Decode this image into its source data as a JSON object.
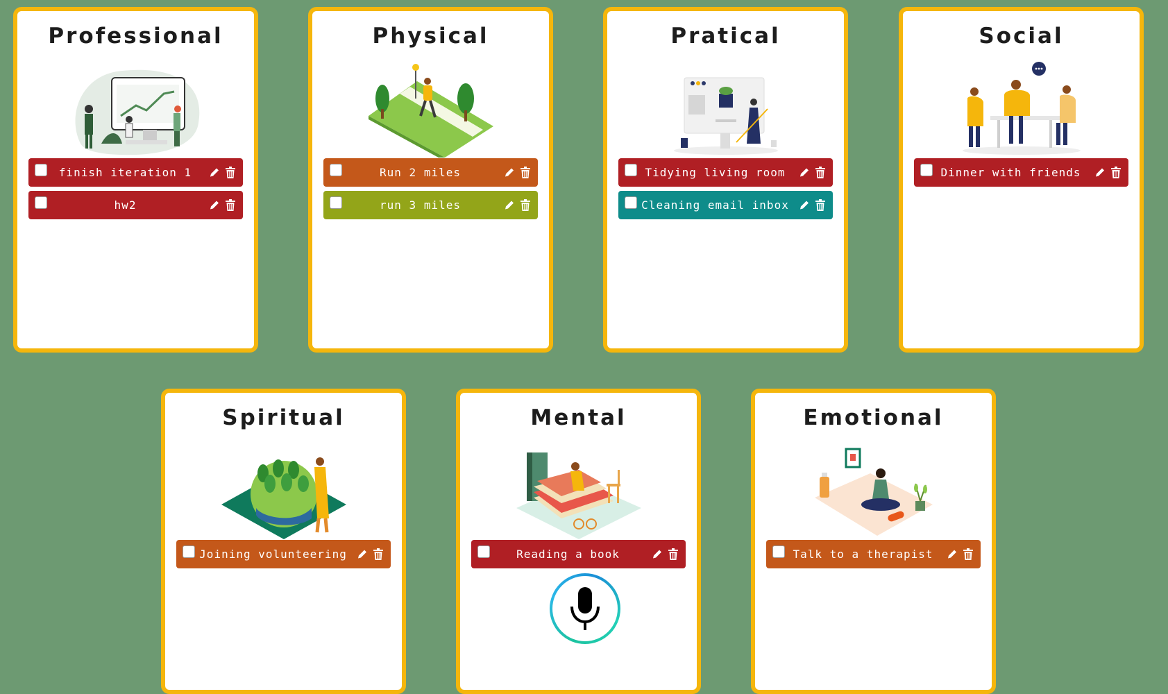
{
  "colors": {
    "background": "#6d9a72",
    "card_border": "#f5b60c",
    "red": "#b01f24",
    "orange": "#c4581a",
    "olive": "#93a519",
    "teal": "#0e8c8a"
  },
  "cards": [
    {
      "title": "Professional",
      "illustration": "presentation-chart-illustration",
      "tasks": [
        {
          "label": "finish iteration 1",
          "color": "#b01f24"
        },
        {
          "label": "hw2",
          "color": "#b01f24"
        }
      ]
    },
    {
      "title": "Physical",
      "illustration": "running-park-illustration",
      "tasks": [
        {
          "label": "Run 2 miles",
          "color": "#c4581a"
        },
        {
          "label": "run 3 miles",
          "color": "#93a519"
        }
      ]
    },
    {
      "title": "Pratical",
      "illustration": "cleaning-desk-illustration",
      "tasks": [
        {
          "label": "Tidying living room",
          "color": "#b01f24"
        },
        {
          "label": "Cleaning email inbox",
          "color": "#0e8c8a"
        }
      ]
    },
    {
      "title": "Social",
      "illustration": "friends-meeting-illustration",
      "tasks": [
        {
          "label": "Dinner with friends",
          "color": "#b01f24"
        }
      ]
    },
    {
      "title": "Spiritual",
      "illustration": "planet-trees-illustration",
      "tasks": [
        {
          "label": "Joining volunteering",
          "color": "#c4581a"
        }
      ]
    },
    {
      "title": "Mental",
      "illustration": "reading-books-illustration",
      "tasks": [
        {
          "label": "Reading a book",
          "color": "#b01f24"
        }
      ]
    },
    {
      "title": "Emotional",
      "illustration": "meditation-illustration",
      "tasks": [
        {
          "label": "Talk to a therapist",
          "color": "#c4581a"
        }
      ]
    }
  ],
  "icons": {
    "edit": "pencil-icon",
    "delete": "trash-icon",
    "voice": "microphone-icon"
  }
}
